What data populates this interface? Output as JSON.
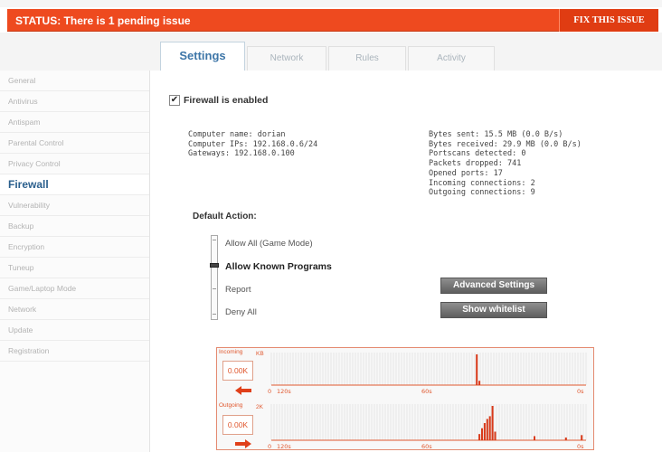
{
  "status": {
    "text": "STATUS: There is 1 pending issue",
    "fix_label": "FIX THIS ISSUE"
  },
  "tabs": [
    {
      "label": "Settings",
      "active": true
    },
    {
      "label": "Network",
      "active": false
    },
    {
      "label": "Rules",
      "active": false
    },
    {
      "label": "Activity",
      "active": false
    }
  ],
  "sidebar": {
    "items": [
      {
        "label": "General"
      },
      {
        "label": "Antivirus"
      },
      {
        "label": "Antispam"
      },
      {
        "label": "Parental Control"
      },
      {
        "label": "Privacy Control"
      },
      {
        "label": "Firewall",
        "active": true
      },
      {
        "label": "Vulnerability"
      },
      {
        "label": "Backup"
      },
      {
        "label": "Encryption"
      },
      {
        "label": "Tuneup"
      },
      {
        "label": "Game/Laptop Mode"
      },
      {
        "label": "Network"
      },
      {
        "label": "Update"
      },
      {
        "label": "Registration"
      }
    ]
  },
  "firewall": {
    "enabled_label": "Firewall is enabled",
    "enabled": true
  },
  "info_left": {
    "computer_name": "Computer name: dorian",
    "computer_ips": "Computer IPs: 192.168.0.6/24",
    "gateways": "Gateways: 192.168.0.100"
  },
  "info_right": {
    "bytes_sent": "Bytes sent: 15.5 MB (0.0 B/s)",
    "bytes_received": "Bytes received: 29.9 MB (0.0 B/s)",
    "portscans": "Portscans detected: 0",
    "packets_dropped": "Packets dropped: 741",
    "opened_ports": "Opened ports: 17",
    "incoming": "Incoming connections: 2",
    "outgoing": "Outgoing connections: 9"
  },
  "default_action": {
    "label": "Default Action:",
    "options": [
      {
        "label": "Allow All (Game Mode)"
      },
      {
        "label": "Allow Known Programs",
        "selected": true
      },
      {
        "label": "Report"
      },
      {
        "label": "Deny All"
      }
    ]
  },
  "buttons": {
    "advanced": "Advanced Settings",
    "whitelist": "Show whitelist"
  },
  "graph": {
    "incoming_label": "Incoming",
    "outgoing_label": "Outgoing",
    "incoming_rate": "0.00K",
    "outgoing_rate": "0.00K",
    "unit_top": "KB",
    "unit_bottom": "2K",
    "time_labels": [
      "120s",
      "60s",
      "0s"
    ],
    "zero_label": "0",
    "incoming_spikes": [
      {
        "t": 78,
        "h": 1.0
      },
      {
        "t": 79,
        "h": 0.14
      }
    ],
    "outgoing_spikes": [
      {
        "t": 79,
        "h": 0.18
      },
      {
        "t": 80,
        "h": 0.35
      },
      {
        "t": 81,
        "h": 0.5
      },
      {
        "t": 82,
        "h": 0.62
      },
      {
        "t": 83,
        "h": 0.7
      },
      {
        "t": 84,
        "h": 1.0
      },
      {
        "t": 85,
        "h": 0.25
      },
      {
        "t": 100,
        "h": 0.12
      },
      {
        "t": 112,
        "h": 0.08
      },
      {
        "t": 118,
        "h": 0.15
      }
    ],
    "colors": {
      "accent": "#e0582f",
      "spike": "#d93a1a",
      "grid": "#e6e6e6"
    }
  },
  "colors": {
    "status_bg": "#ee4a1f",
    "active_text": "#2a5f8d"
  }
}
